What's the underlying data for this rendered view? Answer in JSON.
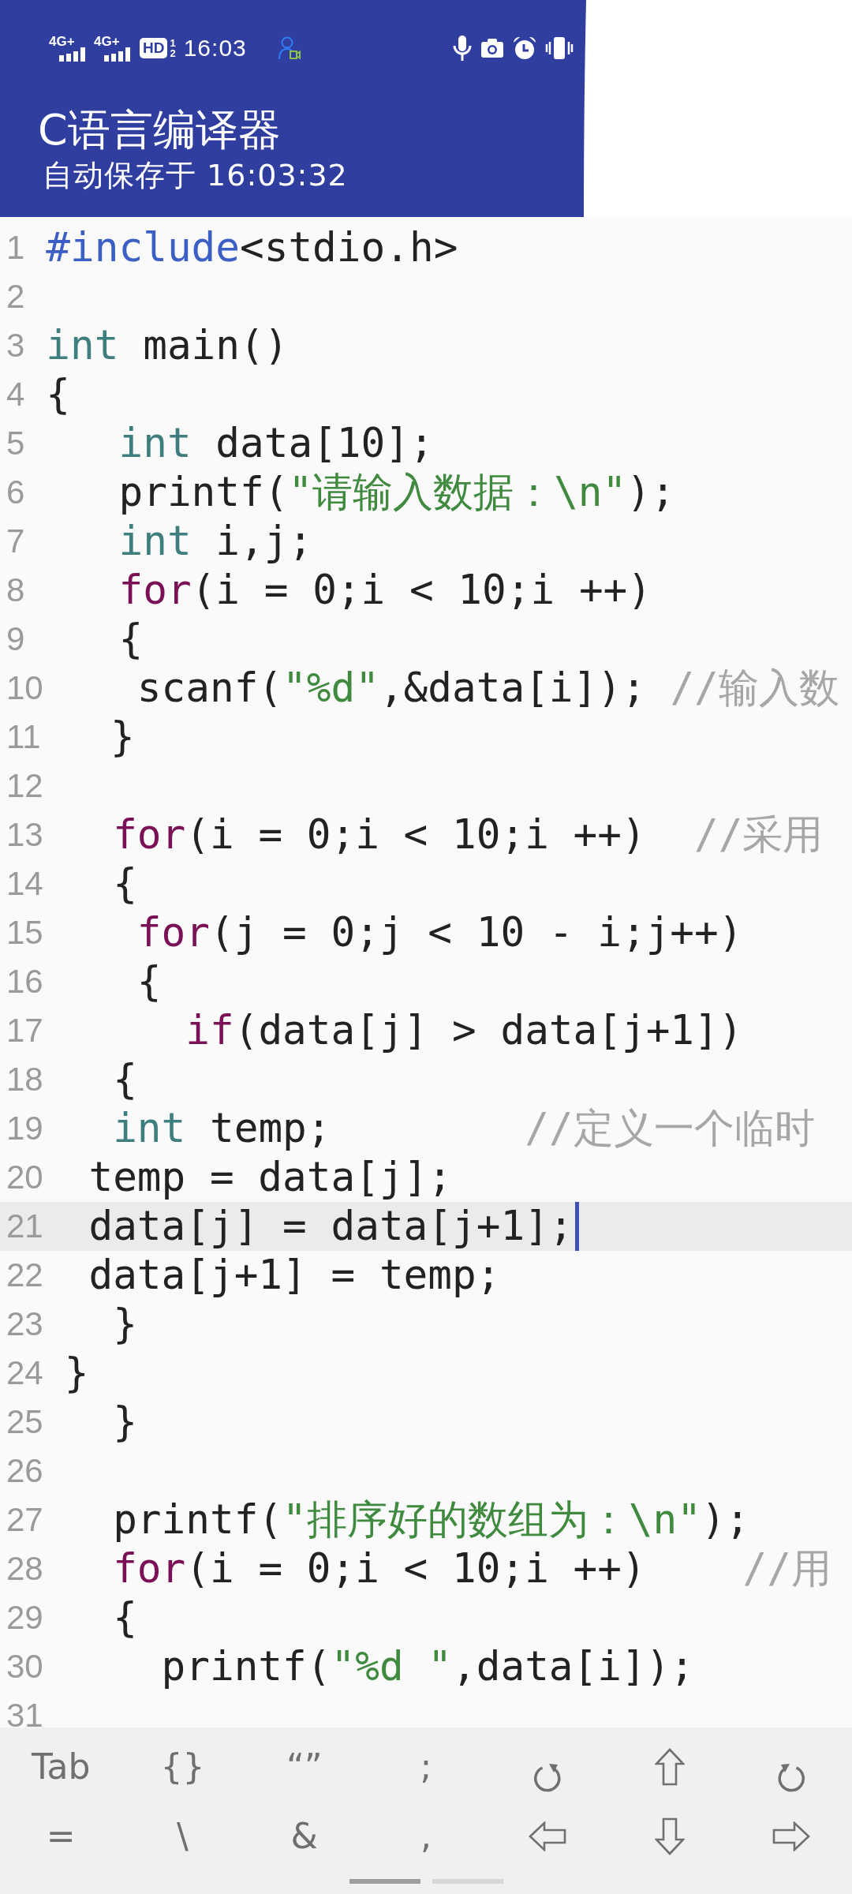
{
  "status_bar": {
    "signals": [
      {
        "network": "4G+"
      },
      {
        "network": "4G+"
      }
    ],
    "hd_badge": {
      "label": "HD",
      "slots": [
        "1",
        "2"
      ]
    },
    "time": "16:03"
  },
  "header": {
    "title": "C语言编译器",
    "subtitle": "自动保存于 16:03:32"
  },
  "editor": {
    "lines": [
      {
        "number": "1",
        "current": false,
        "tokens": [
          {
            "kind": "directive",
            "text": "#include"
          },
          {
            "kind": "plain",
            "text": "<stdio.h>"
          }
        ]
      },
      {
        "number": "2",
        "current": false
      },
      {
        "number": "3",
        "current": false,
        "tokens": [
          {
            "kind": "type",
            "text": "int"
          },
          {
            "kind": "plain",
            "text": " main()"
          }
        ]
      },
      {
        "number": "4",
        "current": false,
        "tokens": [
          {
            "kind": "plain",
            "text": "{"
          }
        ]
      },
      {
        "number": "5",
        "current": false,
        "tokens": [
          {
            "kind": "type",
            "text": "   int"
          },
          {
            "kind": "plain",
            "text": " data[10];"
          }
        ]
      },
      {
        "number": "6",
        "current": false,
        "tokens": [
          {
            "kind": "plain",
            "text": "   printf("
          },
          {
            "kind": "string",
            "text": "\"请输入数据：\\n\""
          },
          {
            "kind": "plain",
            "text": ");"
          }
        ]
      },
      {
        "number": "7",
        "current": false,
        "tokens": [
          {
            "kind": "type",
            "text": "   int"
          },
          {
            "kind": "plain",
            "text": " i,j;"
          }
        ]
      },
      {
        "number": "8",
        "current": false,
        "tokens": [
          {
            "kind": "keyword",
            "text": "   for"
          },
          {
            "kind": "plain",
            "text": "(i = 0;i < 10;i ++)"
          }
        ]
      },
      {
        "number": "9",
        "current": false,
        "tokens": [
          {
            "kind": "plain",
            "text": "   {"
          }
        ]
      },
      {
        "number": "10",
        "current": false,
        "tokens": [
          {
            "kind": "plain",
            "text": "   scanf("
          },
          {
            "kind": "string",
            "text": "\"%d\""
          },
          {
            "kind": "plain",
            "text": ",&data[i]); "
          },
          {
            "kind": "comment",
            "text": "//输入数"
          }
        ]
      },
      {
        "number": "11",
        "current": false,
        "tokens": [
          {
            "kind": "plain",
            "text": "  }"
          }
        ]
      },
      {
        "number": "12",
        "current": false
      },
      {
        "number": "13",
        "current": false,
        "tokens": [
          {
            "kind": "keyword",
            "text": "  for"
          },
          {
            "kind": "plain",
            "text": "(i = 0;i < 10;i ++)  "
          },
          {
            "kind": "comment",
            "text": "//采用"
          }
        ]
      },
      {
        "number": "14",
        "current": false,
        "tokens": [
          {
            "kind": "plain",
            "text": "  {"
          }
        ]
      },
      {
        "number": "15",
        "current": false,
        "tokens": [
          {
            "kind": "keyword",
            "text": "   for"
          },
          {
            "kind": "plain",
            "text": "(j = 0;j < 10 - i;j++)"
          }
        ]
      },
      {
        "number": "16",
        "current": false,
        "tokens": [
          {
            "kind": "plain",
            "text": "   {"
          }
        ]
      },
      {
        "number": "17",
        "current": false,
        "tokens": [
          {
            "kind": "keyword",
            "text": "     if"
          },
          {
            "kind": "plain",
            "text": "(data[j] > data[j+1])"
          }
        ]
      },
      {
        "number": "18",
        "current": false,
        "tokens": [
          {
            "kind": "plain",
            "text": "  {"
          }
        ]
      },
      {
        "number": "19",
        "current": false,
        "tokens": [
          {
            "kind": "type",
            "text": "  int"
          },
          {
            "kind": "plain",
            "text": " temp;        "
          },
          {
            "kind": "comment",
            "text": "//定义一个临时"
          }
        ]
      },
      {
        "number": "20",
        "current": false,
        "tokens": [
          {
            "kind": "plain",
            "text": " temp = data[j];"
          }
        ]
      },
      {
        "number": "21",
        "current": true,
        "tokens": [
          {
            "kind": "plain",
            "text": " data[j] = data[j+1];"
          }
        ]
      },
      {
        "number": "22",
        "current": false,
        "tokens": [
          {
            "kind": "plain",
            "text": " data[j+1] = temp;"
          }
        ]
      },
      {
        "number": "23",
        "current": false,
        "tokens": [
          {
            "kind": "plain",
            "text": "  }"
          }
        ]
      },
      {
        "number": "24",
        "current": false,
        "tokens": [
          {
            "kind": "plain",
            "text": "}"
          }
        ]
      },
      {
        "number": "25",
        "current": false,
        "tokens": [
          {
            "kind": "plain",
            "text": "  }"
          }
        ]
      },
      {
        "number": "26",
        "current": false
      },
      {
        "number": "27",
        "current": false,
        "tokens": [
          {
            "kind": "plain",
            "text": "  printf("
          },
          {
            "kind": "string",
            "text": "\"排序好的数组为：\\n\""
          },
          {
            "kind": "plain",
            "text": ");"
          }
        ]
      },
      {
        "number": "28",
        "current": false,
        "tokens": [
          {
            "kind": "keyword",
            "text": "  for"
          },
          {
            "kind": "plain",
            "text": "(i = 0;i < 10;i ++)    "
          },
          {
            "kind": "comment",
            "text": "//用"
          }
        ]
      },
      {
        "number": "29",
        "current": false,
        "tokens": [
          {
            "kind": "plain",
            "text": "  {"
          }
        ]
      },
      {
        "number": "30",
        "current": false,
        "tokens": [
          {
            "kind": "plain",
            "text": "    printf("
          },
          {
            "kind": "string",
            "text": "\"%d \""
          },
          {
            "kind": "plain",
            "text": ",data[i]);"
          }
        ]
      },
      {
        "number": "31",
        "current": false
      }
    ]
  },
  "shortcut_keys": {
    "rows": [
      [
        {
          "kind": "label",
          "label": "Tab"
        },
        {
          "kind": "label",
          "label": "{}"
        },
        {
          "kind": "label",
          "label": "“”"
        },
        {
          "kind": "label",
          "label": ";"
        },
        {
          "kind": "undo"
        },
        {
          "kind": "up"
        },
        {
          "kind": "redo"
        }
      ],
      [
        {
          "kind": "label",
          "label": "="
        },
        {
          "kind": "label",
          "label": "\\"
        },
        {
          "kind": "label",
          "label": "&"
        },
        {
          "kind": "label",
          "label": ","
        },
        {
          "kind": "left"
        },
        {
          "kind": "down"
        },
        {
          "kind": "right"
        }
      ]
    ]
  },
  "page_indicator": [
    {
      "selected": true
    },
    {
      "selected": false
    }
  ]
}
